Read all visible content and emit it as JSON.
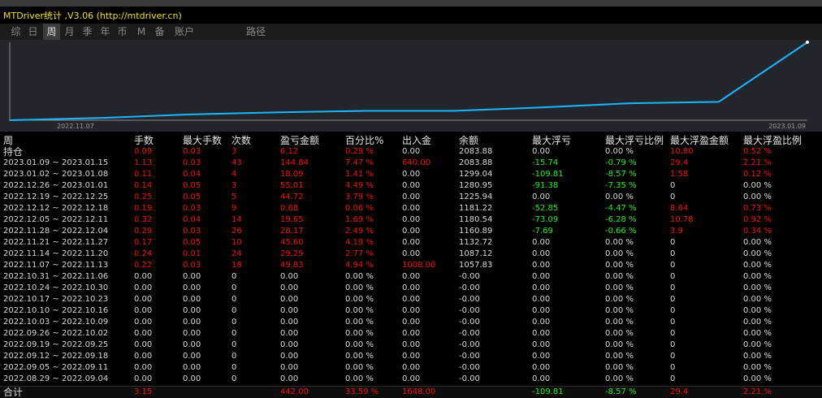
{
  "window": {
    "title": "MTDriver统计 ,V3.06 (http://mtdriver.cn)"
  },
  "tabs": [
    {
      "label": "综",
      "active": false
    },
    {
      "label": "日",
      "active": false
    },
    {
      "label": "周",
      "active": true
    },
    {
      "label": "月",
      "active": false
    },
    {
      "label": "季",
      "active": false
    },
    {
      "label": "年",
      "active": false
    },
    {
      "label": "币",
      "active": false
    },
    {
      "label": "M",
      "active": false
    },
    {
      "label": "备",
      "active": false
    },
    {
      "label": "账户",
      "active": false
    },
    {
      "label": "路径",
      "active": false
    }
  ],
  "chart_data": {
    "type": "line",
    "x": [
      "2022.11.07",
      "2022.11.14",
      "2022.11.21",
      "2022.11.28",
      "2022.12.05",
      "2022.12.12",
      "2022.12.19",
      "2022.12.26",
      "2023.01.02",
      "2023.01.09"
    ],
    "y": [
      1057.83,
      1087.12,
      1132.72,
      1160.89,
      1180.54,
      1181.22,
      1225.94,
      1280.95,
      1299.04,
      2083.88
    ],
    "series": [
      {
        "values": [
          1057.83,
          1087.12,
          1132.72,
          1160.89,
          1180.54,
          1181.22,
          1225.94,
          1280.95,
          1299.04,
          2083.88
        ]
      }
    ],
    "x_tick_labels": [
      "2022.11.07",
      "2023.01.09"
    ],
    "line_color": "#1eb4ff",
    "background_color": "#22262c"
  },
  "table": {
    "columns": [
      "周",
      "手数",
      "最大手数",
      "次数",
      "盈亏金额",
      "百分比%",
      "出入金",
      "余额",
      "最大浮亏",
      "最大浮亏比例",
      "最大浮盈金额",
      "最大浮盈比例"
    ],
    "rows": [
      {
        "c": [
          "持仓",
          "0.09",
          "0.03",
          "3",
          "6.12",
          "0.29 %",
          "0.00",
          "2083.88",
          "0.00",
          "0.00 %",
          "10.80",
          "0.52 %"
        ],
        "k": [
          "w",
          "r",
          "r",
          "r",
          "r",
          "r",
          "w",
          "w",
          "w",
          "w",
          "r",
          "r"
        ]
      },
      {
        "c": [
          "2023.01.09 ~ 2023.01.15",
          "1.13",
          "0.03",
          "43",
          "144.84",
          "7.47 %",
          "640.00",
          "2083.88",
          "-15.74",
          "-0.79 %",
          "29.4",
          "2.21 %"
        ],
        "k": [
          "w",
          "r",
          "r",
          "r",
          "r",
          "r",
          "r",
          "w",
          "g",
          "g",
          "r",
          "r"
        ]
      },
      {
        "c": [
          "2023.01.02 ~ 2023.01.08",
          "0.11",
          "0.04",
          "4",
          "18.09",
          "1.41 %",
          "0.00",
          "1299.04",
          "-109.81",
          "-8.57 %",
          "1.58",
          "0.12 %"
        ],
        "k": [
          "w",
          "r",
          "r",
          "r",
          "r",
          "r",
          "w",
          "w",
          "g",
          "g",
          "r",
          "r"
        ]
      },
      {
        "c": [
          "2022.12.26 ~ 2023.01.01",
          "0.14",
          "0.05",
          "3",
          "55.01",
          "4.49 %",
          "0.00",
          "1280.95",
          "-91.38",
          "-7.35 %",
          "0",
          "0.00 %"
        ],
        "k": [
          "w",
          "r",
          "r",
          "r",
          "r",
          "r",
          "w",
          "w",
          "g",
          "g",
          "w",
          "w"
        ]
      },
      {
        "c": [
          "2022.12.19 ~ 2022.12.25",
          "0.25",
          "0.05",
          "5",
          "44.72",
          "3.79 %",
          "0.00",
          "1225.94",
          "0.00",
          "0.00 %",
          "0",
          "0.00 %"
        ],
        "k": [
          "w",
          "r",
          "r",
          "r",
          "r",
          "r",
          "w",
          "w",
          "w",
          "w",
          "w",
          "w"
        ]
      },
      {
        "c": [
          "2022.12.12 ~ 2022.12.18",
          "0.19",
          "0.03",
          "9",
          "0.68",
          "0.06 %",
          "0.00",
          "1181.22",
          "-52.85",
          "-4.47 %",
          "8.64",
          "0.73 %"
        ],
        "k": [
          "w",
          "r",
          "r",
          "r",
          "r",
          "r",
          "w",
          "w",
          "g",
          "g",
          "r",
          "r"
        ]
      },
      {
        "c": [
          "2022.12.05 ~ 2022.12.11",
          "0.32",
          "0.04",
          "14",
          "19.65",
          "1.69 %",
          "0.00",
          "1180.54",
          "-73.09",
          "-6.28 %",
          "10.78",
          "0.92 %"
        ],
        "k": [
          "w",
          "r",
          "r",
          "r",
          "r",
          "r",
          "w",
          "w",
          "g",
          "g",
          "r",
          "r"
        ]
      },
      {
        "c": [
          "2022.11.28 ~ 2022.12.04",
          "0.29",
          "0.03",
          "26",
          "28.17",
          "2.49 %",
          "0.00",
          "1160.89",
          "-7.69",
          "-0.66 %",
          "3.9",
          "0.34 %"
        ],
        "k": [
          "w",
          "r",
          "r",
          "r",
          "r",
          "r",
          "w",
          "w",
          "g",
          "g",
          "r",
          "r"
        ]
      },
      {
        "c": [
          "2022.11.21 ~ 2022.11.27",
          "0.17",
          "0.05",
          "10",
          "45.60",
          "4.19 %",
          "0.00",
          "1132.72",
          "0.00",
          "0.00 %",
          "0",
          "0.00 %"
        ],
        "k": [
          "w",
          "r",
          "r",
          "r",
          "r",
          "r",
          "w",
          "w",
          "w",
          "w",
          "w",
          "w"
        ]
      },
      {
        "c": [
          "2022.11.14 ~ 2022.11.20",
          "0.24",
          "0.01",
          "24",
          "29.29",
          "2.77 %",
          "0.00",
          "1087.12",
          "0.00",
          "0.00 %",
          "0",
          "0.00 %"
        ],
        "k": [
          "w",
          "r",
          "r",
          "r",
          "r",
          "r",
          "w",
          "w",
          "w",
          "w",
          "w",
          "w"
        ]
      },
      {
        "c": [
          "2022.11.07 ~ 2022.11.13",
          "0.22",
          "0.03",
          "18",
          "49.83",
          "4.94 %",
          "1008.00",
          "1057.83",
          "0.00",
          "0.00 %",
          "0",
          "0.00 %"
        ],
        "k": [
          "w",
          "r",
          "r",
          "r",
          "r",
          "r",
          "r",
          "w",
          "w",
          "w",
          "w",
          "w"
        ]
      },
      {
        "c": [
          "2022.10.31 ~ 2022.11.06",
          "0.00",
          "0.00",
          "0",
          "0.00",
          "0.00 %",
          "0.00",
          "-0.00",
          "0.00",
          "0.00 %",
          "0",
          "0.00 %"
        ],
        "k": [
          "w",
          "w",
          "w",
          "w",
          "w",
          "w",
          "w",
          "w",
          "w",
          "w",
          "w",
          "w"
        ]
      },
      {
        "c": [
          "2022.10.24 ~ 2022.10.30",
          "0.00",
          "0.00",
          "0",
          "0.00",
          "0.00 %",
          "0.00",
          "-0.00",
          "0.00",
          "0.00 %",
          "0",
          "0.00 %"
        ],
        "k": [
          "w",
          "w",
          "w",
          "w",
          "w",
          "w",
          "w",
          "w",
          "w",
          "w",
          "w",
          "w"
        ]
      },
      {
        "c": [
          "2022.10.17 ~ 2022.10.23",
          "0.00",
          "0.00",
          "0",
          "0.00",
          "0.00 %",
          "0.00",
          "-0.00",
          "0.00",
          "0.00 %",
          "0",
          "0.00 %"
        ],
        "k": [
          "w",
          "w",
          "w",
          "w",
          "w",
          "w",
          "w",
          "w",
          "w",
          "w",
          "w",
          "w"
        ]
      },
      {
        "c": [
          "2022.10.10 ~ 2022.10.16",
          "0.00",
          "0.00",
          "0",
          "0.00",
          "0.00 %",
          "0.00",
          "-0.00",
          "0.00",
          "0.00 %",
          "0",
          "0.00 %"
        ],
        "k": [
          "w",
          "w",
          "w",
          "w",
          "w",
          "w",
          "w",
          "w",
          "w",
          "w",
          "w",
          "w"
        ]
      },
      {
        "c": [
          "2022.10.03 ~ 2022.10.09",
          "0.00",
          "0.00",
          "0",
          "0.00",
          "0.00 %",
          "0.00",
          "-0.00",
          "0.00",
          "0.00 %",
          "0",
          "0.00 %"
        ],
        "k": [
          "w",
          "w",
          "w",
          "w",
          "w",
          "w",
          "w",
          "w",
          "w",
          "w",
          "w",
          "w"
        ]
      },
      {
        "c": [
          "2022.09.26 ~ 2022.10.02",
          "0.00",
          "0.00",
          "0",
          "0.00",
          "0.00 %",
          "0.00",
          "-0.00",
          "0.00",
          "0.00 %",
          "0",
          "0.00 %"
        ],
        "k": [
          "w",
          "w",
          "w",
          "w",
          "w",
          "w",
          "w",
          "w",
          "w",
          "w",
          "w",
          "w"
        ]
      },
      {
        "c": [
          "2022.09.19 ~ 2022.09.25",
          "0.00",
          "0.00",
          "0",
          "0.00",
          "0.00 %",
          "0.00",
          "-0.00",
          "0.00",
          "0.00 %",
          "0",
          "0.00 %"
        ],
        "k": [
          "w",
          "w",
          "w",
          "w",
          "w",
          "w",
          "w",
          "w",
          "w",
          "w",
          "w",
          "w"
        ]
      },
      {
        "c": [
          "2022.09.12 ~ 2022.09.18",
          "0.00",
          "0.00",
          "0",
          "0.00",
          "0.00 %",
          "0.00",
          "-0.00",
          "0.00",
          "0.00 %",
          "0",
          "0.00 %"
        ],
        "k": [
          "w",
          "w",
          "w",
          "w",
          "w",
          "w",
          "w",
          "w",
          "w",
          "w",
          "w",
          "w"
        ]
      },
      {
        "c": [
          "2022.09.05 ~ 2022.09.11",
          "0.00",
          "0.00",
          "0",
          "0.00",
          "0.00 %",
          "0.00",
          "-0.00",
          "0.00",
          "0.00 %",
          "0",
          "0.00 %"
        ],
        "k": [
          "w",
          "w",
          "w",
          "w",
          "w",
          "w",
          "w",
          "w",
          "w",
          "w",
          "w",
          "w"
        ]
      },
      {
        "c": [
          "2022.08.29 ~ 2022.09.04",
          "0.00",
          "0.00",
          "0",
          "0.00",
          "0.00 %",
          "0.00",
          "-0.00",
          "0.00",
          "0.00 %",
          "0",
          "0.00 %"
        ],
        "k": [
          "w",
          "w",
          "w",
          "w",
          "w",
          "w",
          "w",
          "w",
          "w",
          "w",
          "w",
          "w"
        ]
      }
    ],
    "total": {
      "c": [
        "合计",
        "3.15",
        "",
        "",
        "442.00",
        "33.59 %",
        "1648.00",
        "",
        "-109.81",
        "-8.57 %",
        "29.4",
        "2.21 %"
      ],
      "k": [
        "w",
        "r",
        "w",
        "w",
        "r",
        "r",
        "r",
        "w",
        "g",
        "g",
        "r",
        "r"
      ]
    }
  }
}
